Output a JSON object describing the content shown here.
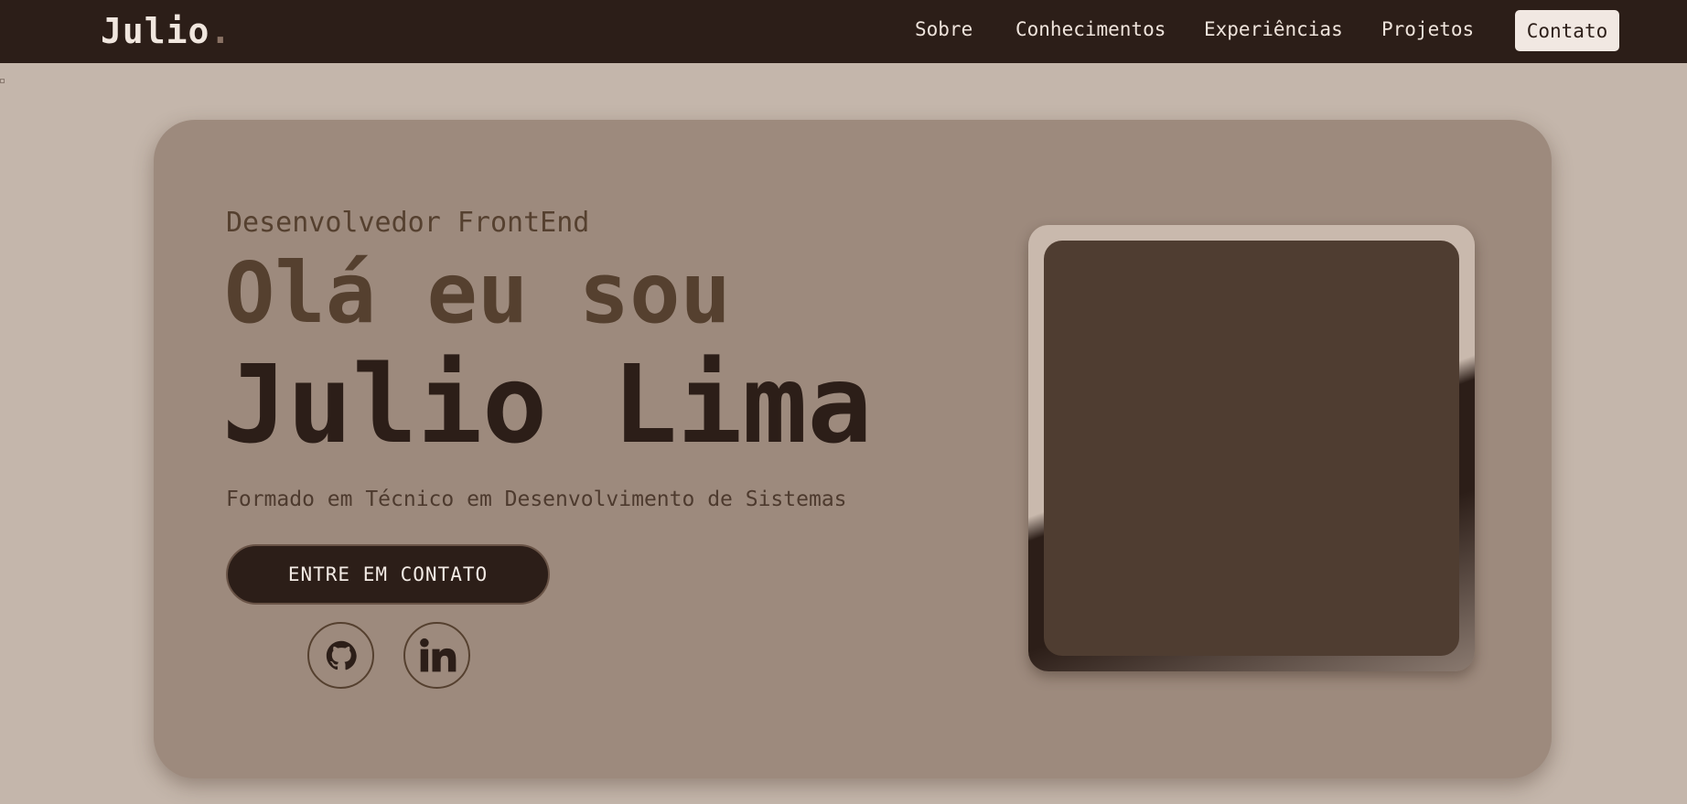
{
  "header": {
    "logo": "Julio",
    "logo_dot": ".",
    "nav": [
      "Sobre",
      "Conhecimentos",
      "Experiências",
      "Projetos"
    ],
    "contact_label": "Contato"
  },
  "hero": {
    "subtitle": "Desenvolvedor FrontEnd",
    "greeting": "Olá eu sou",
    "name": "Julio Lima",
    "formation": "Formado em Técnico em Desenvolvimento de Sistemas",
    "cta_label": "ENTRE EM CONTATO",
    "socials": [
      {
        "icon": "github-icon"
      },
      {
        "icon": "linkedin-icon"
      }
    ]
  },
  "colors": {
    "nav_bg": "#2c1e18",
    "page_bg": "#c4b6ab",
    "card_bg": "#9d8a7d",
    "accent_dark": "#2c1e18",
    "text_brown": "#55402f"
  }
}
